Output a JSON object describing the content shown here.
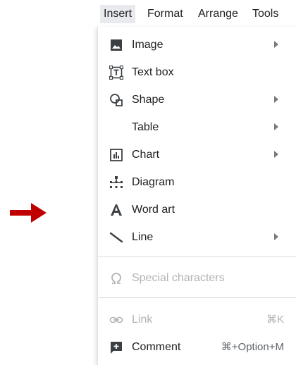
{
  "menubar": {
    "items": [
      {
        "label": "Insert",
        "active": true
      },
      {
        "label": "Format"
      },
      {
        "label": "Arrange"
      },
      {
        "label": "Tools"
      }
    ]
  },
  "insert_menu": {
    "items": [
      {
        "label": "Image",
        "icon": "image-icon",
        "submenu": true
      },
      {
        "label": "Text box",
        "icon": "text-box-icon"
      },
      {
        "label": "Shape",
        "icon": "shape-icon",
        "submenu": true
      },
      {
        "label": "Table",
        "submenu": true
      },
      {
        "label": "Chart",
        "icon": "chart-icon",
        "submenu": true
      },
      {
        "label": "Diagram",
        "icon": "diagram-icon"
      },
      {
        "label": "Word art",
        "icon": "word-art-icon"
      },
      {
        "label": "Line",
        "icon": "line-icon",
        "submenu": true
      },
      {
        "label": "Special characters",
        "icon": "omega-icon",
        "disabled": true
      },
      {
        "label": "Link",
        "icon": "link-icon",
        "shortcut": "⌘K",
        "disabled": true
      },
      {
        "label": "Comment",
        "icon": "comment-icon",
        "shortcut": "⌘+Option+M"
      }
    ]
  },
  "annotation": {
    "color": "#c00000",
    "icon": "arrow-right-icon"
  }
}
